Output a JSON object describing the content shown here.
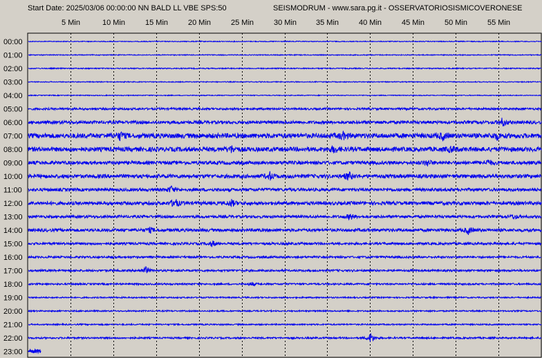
{
  "header": {
    "left": "Start Date: 2025/03/06 00:00:00 NN BALD LL VBE SPS:50",
    "right": "SEISMODRUM - www.sara.pg.it - OSSERVATORIOSISMICOVERONESE"
  },
  "colors": {
    "background": "#d4d0c8",
    "trace": "#0000ee",
    "grid": "#000000"
  },
  "chart_data": {
    "type": "line",
    "title": "",
    "x_tick_labels": [
      "5 Min",
      "10 Min",
      "15 Min",
      "20 Min",
      "25 Min",
      "30 Min",
      "35 Min",
      "40 Min",
      "45 Min",
      "50 Min",
      "55 Min"
    ],
    "x_ticks_minutes": [
      5,
      10,
      15,
      20,
      25,
      30,
      35,
      40,
      45,
      50,
      55
    ],
    "xlim_minutes": [
      0,
      60
    ],
    "hour_labels": [
      "00:00",
      "01:00",
      "02:00",
      "03:00",
      "04:00",
      "05:00",
      "06:00",
      "07:00",
      "08:00",
      "09:00",
      "10:00",
      "11:00",
      "12:00",
      "13:00",
      "14:00",
      "15:00",
      "16:00",
      "17:00",
      "18:00",
      "19:00",
      "20:00",
      "21:00",
      "22:00",
      "23:00"
    ],
    "grid": "vertical dashed lines every 5 minutes",
    "trace_noise_level": [
      0.12,
      0.12,
      0.15,
      0.12,
      0.12,
      0.3,
      0.45,
      0.7,
      0.65,
      0.5,
      0.55,
      0.45,
      0.5,
      0.4,
      0.45,
      0.35,
      0.3,
      0.3,
      0.25,
      0.2,
      0.2,
      0.2,
      0.25,
      0.4
    ],
    "events": [
      {
        "hour": 6,
        "minute": 55.5,
        "amplitude": 1.2
      },
      {
        "hour": 7,
        "minute": 10.8,
        "amplitude": 1.0
      },
      {
        "hour": 7,
        "minute": 36.8,
        "amplitude": 0.9
      },
      {
        "hour": 7,
        "minute": 48.5,
        "amplitude": 0.9
      },
      {
        "hour": 7,
        "minute": 54.8,
        "amplitude": 0.8
      },
      {
        "hour": 8,
        "minute": 23.8,
        "amplitude": 0.8
      },
      {
        "hour": 8,
        "minute": 35.8,
        "amplitude": 0.9
      },
      {
        "hour": 8,
        "minute": 49.5,
        "amplitude": 0.7
      },
      {
        "hour": 9,
        "minute": 46.7,
        "amplitude": 0.8
      },
      {
        "hour": 9,
        "minute": 53.8,
        "amplitude": 0.8
      },
      {
        "hour": 10,
        "minute": 28.3,
        "amplitude": 1.0
      },
      {
        "hour": 10,
        "minute": 37.5,
        "amplitude": 1.1
      },
      {
        "hour": 11,
        "minute": 16.8,
        "amplitude": 0.9
      },
      {
        "hour": 12,
        "minute": 17.2,
        "amplitude": 1.3
      },
      {
        "hour": 12,
        "minute": 23.8,
        "amplitude": 0.9
      },
      {
        "hour": 13,
        "minute": 37.7,
        "amplitude": 0.8
      },
      {
        "hour": 13,
        "minute": 56.8,
        "amplitude": 0.6
      },
      {
        "hour": 14,
        "minute": 51.5,
        "amplitude": 1.0
      },
      {
        "hour": 14,
        "minute": 14.3,
        "amplitude": 0.6
      },
      {
        "hour": 15,
        "minute": 21.6,
        "amplitude": 0.8
      },
      {
        "hour": 17,
        "minute": 13.8,
        "amplitude": 1.0
      },
      {
        "hour": 18,
        "minute": 26.2,
        "amplitude": 0.5
      },
      {
        "hour": 22,
        "minute": 40.1,
        "amplitude": 1.4
      }
    ],
    "last_hour_recorded_until_minute": 1.5
  }
}
